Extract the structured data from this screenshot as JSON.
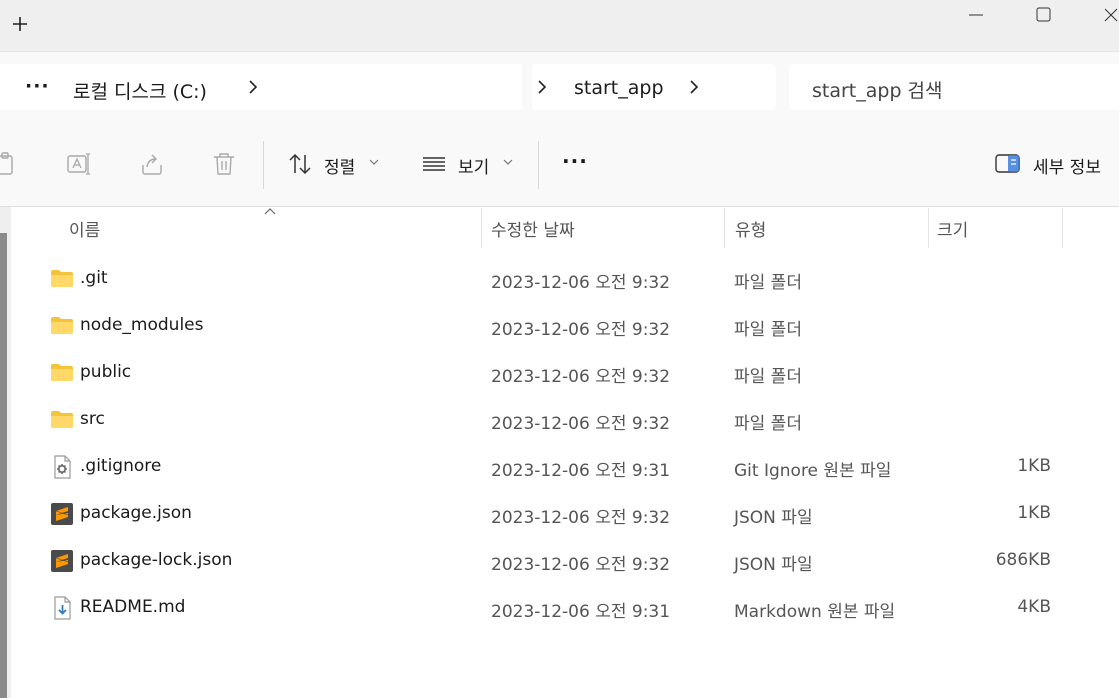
{
  "titlebar": {
    "new_tab_icon": "plus-icon"
  },
  "address": {
    "more": "···",
    "drive": "로컬 디스크 (C:)",
    "folder": "start_app",
    "search_placeholder": "start_app 검색"
  },
  "toolbar": {
    "sort_label": "정렬",
    "view_label": "보기",
    "more_label": "···",
    "details_label": "세부 정보"
  },
  "columns": {
    "name": "이름",
    "date": "수정한 날짜",
    "type": "유형",
    "size": "크기"
  },
  "files": [
    {
      "name": ".git",
      "date": "2023-12-06 오전 9:32",
      "type": "파일 폴더",
      "size": "",
      "icon": "folder-icon"
    },
    {
      "name": "node_modules",
      "date": "2023-12-06 오전 9:32",
      "type": "파일 폴더",
      "size": "",
      "icon": "folder-icon"
    },
    {
      "name": "public",
      "date": "2023-12-06 오전 9:32",
      "type": "파일 폴더",
      "size": "",
      "icon": "folder-icon"
    },
    {
      "name": "src",
      "date": "2023-12-06 오전 9:32",
      "type": "파일 폴더",
      "size": "",
      "icon": "folder-icon"
    },
    {
      "name": ".gitignore",
      "date": "2023-12-06 오전 9:31",
      "type": "Git Ignore 원본 파일",
      "size": "1KB",
      "icon": "settings-file-icon"
    },
    {
      "name": "package.json",
      "date": "2023-12-06 오전 9:32",
      "type": "JSON 파일",
      "size": "1KB",
      "icon": "sublime-file-icon"
    },
    {
      "name": "package-lock.json",
      "date": "2023-12-06 오전 9:32",
      "type": "JSON 파일",
      "size": "686KB",
      "icon": "sublime-file-icon"
    },
    {
      "name": "README.md",
      "date": "2023-12-06 오전 9:31",
      "type": "Markdown 원본 파일",
      "size": "4KB",
      "icon": "markdown-file-icon"
    }
  ]
}
